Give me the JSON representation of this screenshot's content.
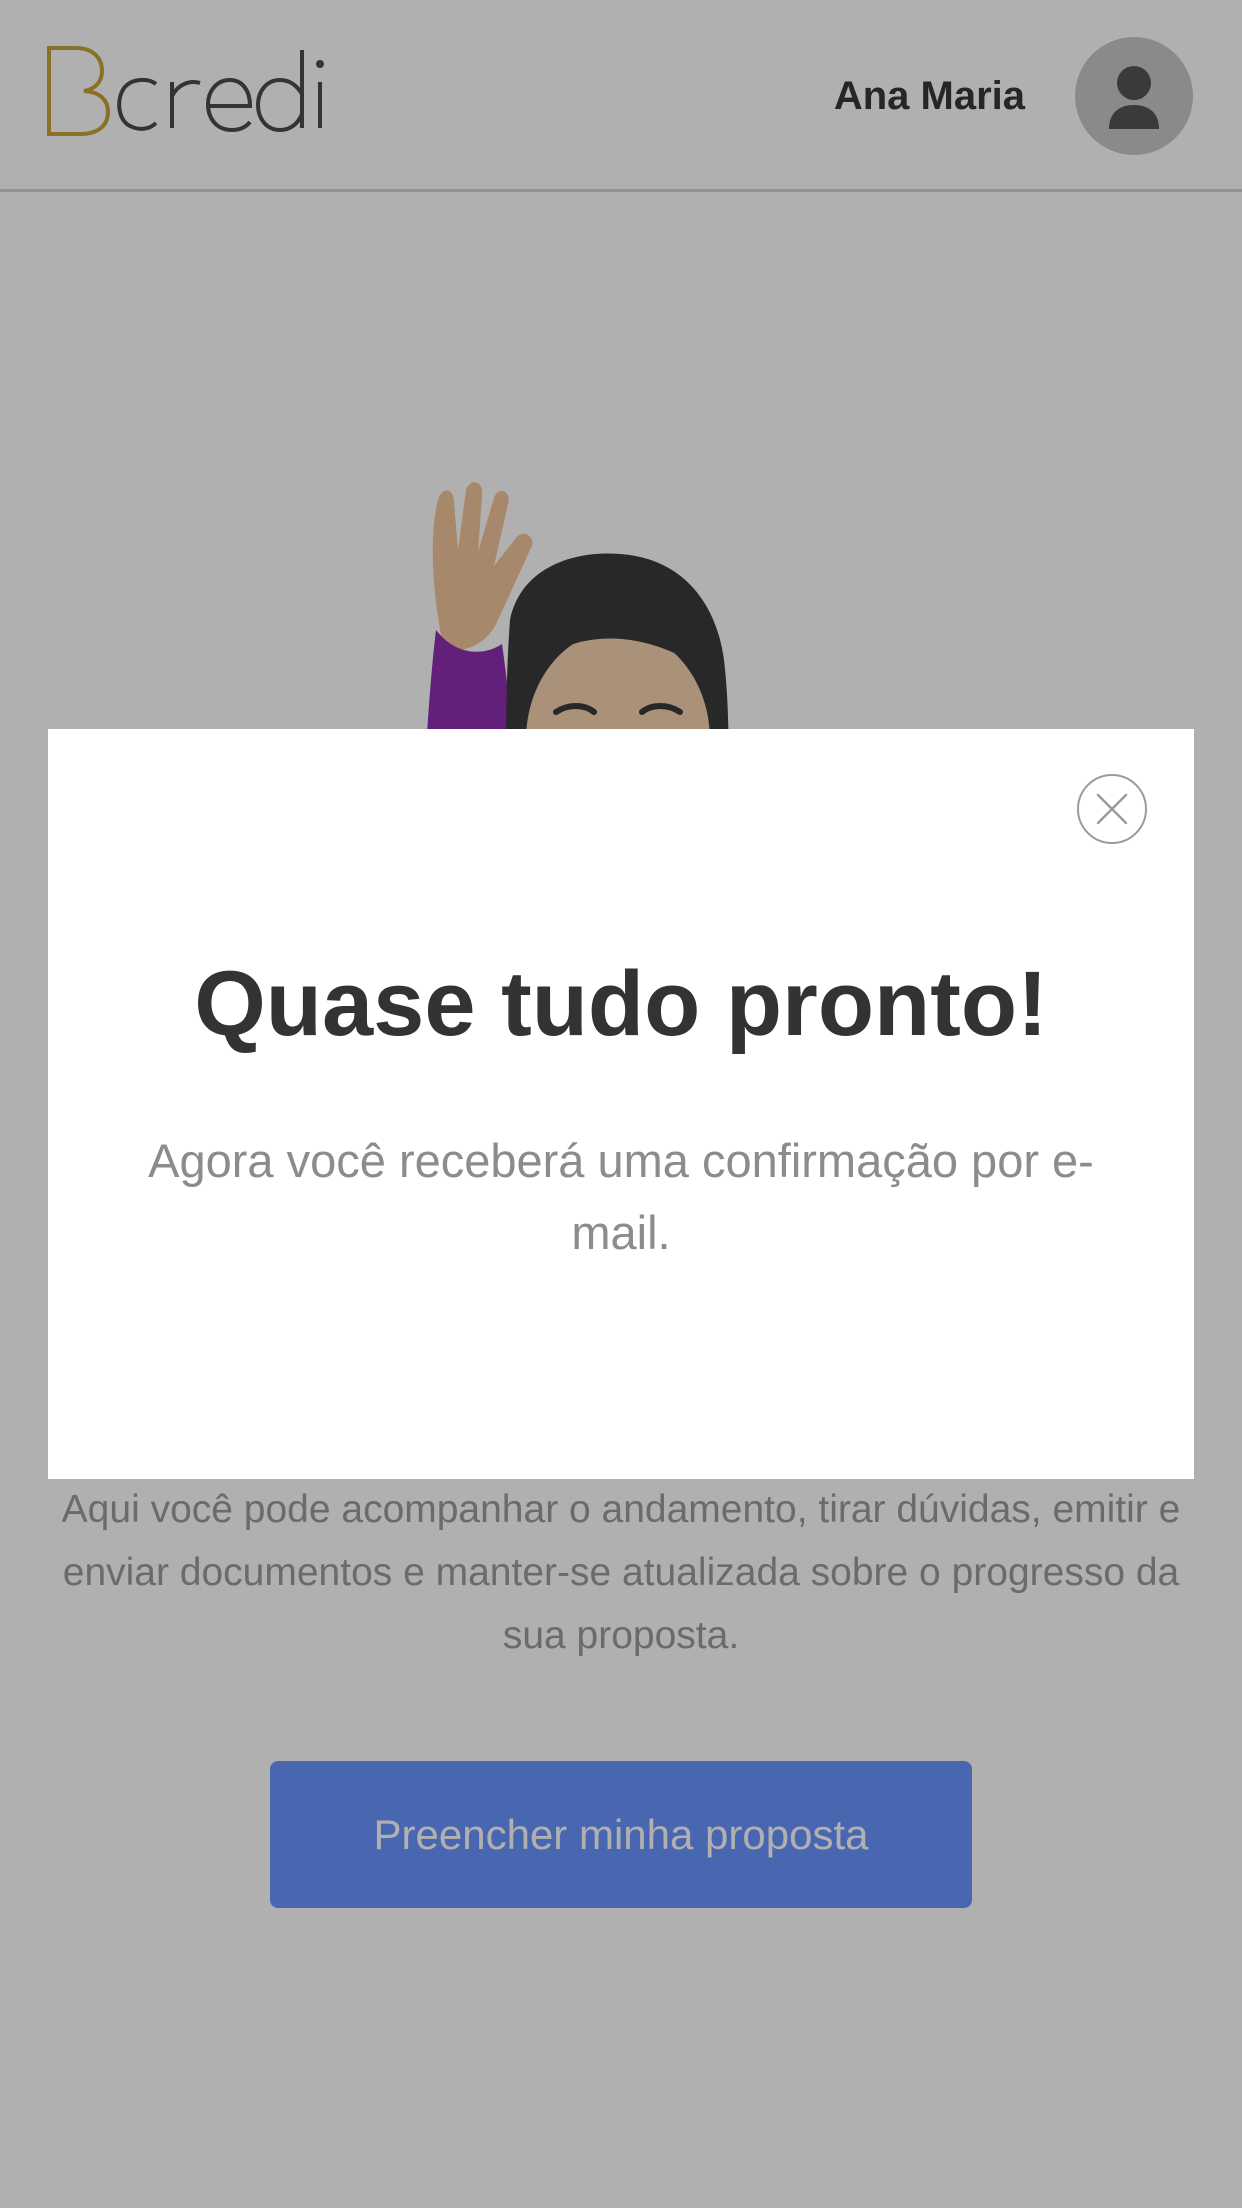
{
  "header": {
    "logo_text": "Bcredi",
    "user_name": "Ana Maria",
    "avatar_icon": "user-silhouette-icon"
  },
  "main": {
    "illustration_icon": "woman-raising-hand-emoji",
    "description": "Aqui você pode acompanhar o andamento, tirar dúvidas, emitir e enviar documentos e manter-se atualizada sobre o progresso da sua proposta.",
    "cta_label": "Preencher minha proposta"
  },
  "modal": {
    "title": "Quase tudo pronto!",
    "message": "Agora você receberá uma confirmação por e-mail.",
    "close_icon": "close-icon"
  },
  "colors": {
    "brand_gold": "#c9a43a",
    "brand_dark": "#4a4a52",
    "cta_blue": "#6b96ff",
    "overlay": "rgba(0,0,0,0.31)"
  }
}
